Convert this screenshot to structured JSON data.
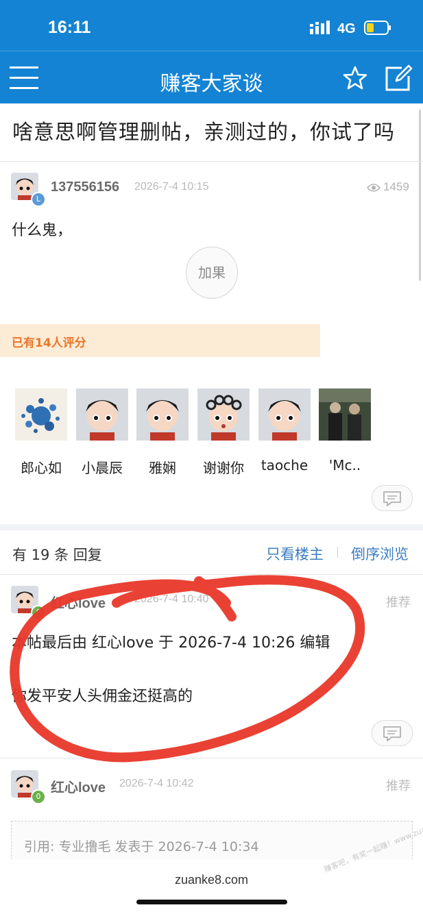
{
  "status_bar": {
    "time": "16:11",
    "network": "4G"
  },
  "navbar": {
    "title": "赚客大家谈"
  },
  "post": {
    "title": "啥意思啊管理删帖，亲测过的，你试了吗",
    "author": "137556156",
    "author_level": "L",
    "date": "2026-7-4 10:15",
    "views": "1459",
    "content": "什么鬼，",
    "plus_label": "加果",
    "rating_summary": "已有14人评分",
    "raters": [
      {
        "name": "郎心如"
      },
      {
        "name": "小晨辰"
      },
      {
        "name": "雅娴"
      },
      {
        "name": "谢谢你"
      },
      {
        "name": "taoche"
      },
      {
        "name": "'Mc.."
      }
    ]
  },
  "replies_header": {
    "count_text": "有 19 条 回复",
    "only_op": "只看楼主",
    "reverse": "倒序浏览"
  },
  "replies": [
    {
      "author": "红心love",
      "level": "0",
      "date": "2026-7-4 10:40",
      "recommend": "推荐",
      "edit_note": "本帖最后由 红心love 于 2026-7-4 10:26 编辑",
      "content": "你发平安人头佣金还挺高的"
    },
    {
      "author": "红心love",
      "level": "0",
      "date": "2026-7-4 10:42",
      "recommend": "推荐",
      "quote": "引用: 专业撸毛 发表于 2026-7-4 10:34"
    }
  ],
  "footer": {
    "url": "zuanke8.com",
    "watermark": "赚客吧，有奖一起赚！www.zuanke8.com"
  },
  "colors": {
    "primary": "#1483d3",
    "annotation": "#e8382a",
    "rating_bg": "#fdecd5",
    "rating_text": "#e8762b",
    "link": "#3b7dc0"
  }
}
